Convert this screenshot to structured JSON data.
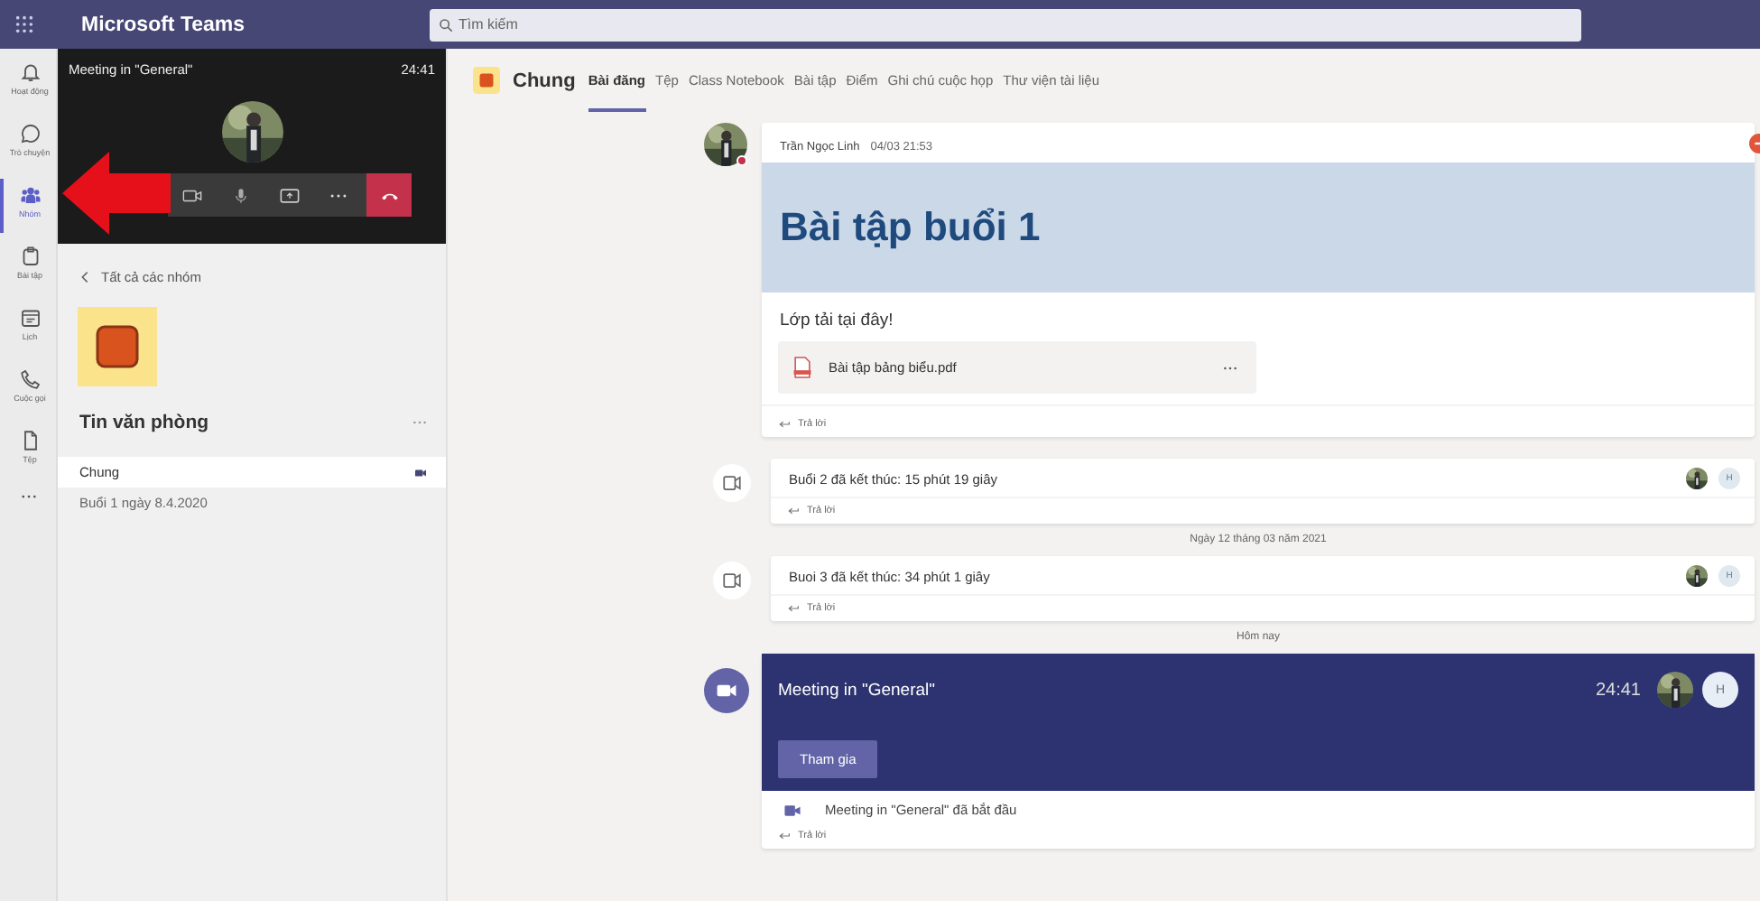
{
  "app": {
    "title": "Microsoft Teams"
  },
  "search": {
    "placeholder": "Tìm kiếm"
  },
  "rail": [
    {
      "label": "Hoạt động",
      "kind": "bell",
      "selected": false
    },
    {
      "label": "Trò chuyện",
      "kind": "chat",
      "selected": false
    },
    {
      "label": "Nhóm",
      "kind": "team",
      "selected": true
    },
    {
      "label": "Bài tập",
      "kind": "bag",
      "selected": false
    },
    {
      "label": "Lịch",
      "kind": "calendar",
      "selected": false
    },
    {
      "label": "Cuộc gọi",
      "kind": "phone",
      "selected": false
    },
    {
      "label": "Tệp",
      "kind": "file",
      "selected": false
    }
  ],
  "call": {
    "title": "Meeting in \"General\"",
    "time": "24:41"
  },
  "team_panel": {
    "back": "Tất cả các nhóm",
    "name": "Tin văn phòng",
    "channels": [
      {
        "name": "Chung",
        "selected": true
      },
      {
        "name": "Buổi 1 ngày 8.4.2020",
        "selected": false
      }
    ]
  },
  "channel": {
    "name": "Chung",
    "tabs": [
      {
        "label": "Bài đăng",
        "selected": true
      },
      {
        "label": "Tệp",
        "selected": false
      },
      {
        "label": "Class Notebook",
        "selected": false
      },
      {
        "label": "Bài tập",
        "selected": false
      },
      {
        "label": "Điểm",
        "selected": false
      },
      {
        "label": "Ghi chú cuộc họp",
        "selected": false
      },
      {
        "label": "Thư viện tài liệu",
        "selected": false
      }
    ]
  },
  "feed": [
    {
      "kind": "post",
      "author": "Trần Ngọc Linh",
      "time": "04/03 21:53",
      "heading": "Bài tập buổi 1",
      "text": "Lớp tải tại đây!",
      "file": "Bài tập bảng biểu.pdf",
      "reply": "Trả lời"
    },
    {
      "kind": "event",
      "text": "Buổi 2 đã kết thúc: 15 phút 19 giây",
      "initial": "H",
      "reply": "Trả lời"
    },
    {
      "kind": "divider",
      "text": "Ngày 12 tháng 03 năm 2021"
    },
    {
      "kind": "event",
      "text": "Buoi 3 đã kết thúc: 34 phút 1 giây",
      "initial": "H",
      "reply": "Trả lời"
    },
    {
      "kind": "divider",
      "text": "Hôm nay"
    },
    {
      "kind": "meeting",
      "title": "Meeting in \"General\"",
      "time": "24:41",
      "initial": "H",
      "button": "Tham gia",
      "status": "Meeting in \"General\" đã bắt đầu",
      "reply": "Trả lời"
    }
  ]
}
